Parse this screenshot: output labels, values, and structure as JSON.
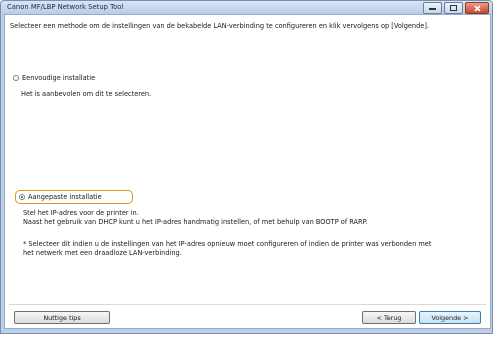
{
  "window": {
    "title": "Canon MF/LBP Network Setup Tool",
    "controls": [
      "minimize-icon",
      "maximize-icon",
      "close-icon"
    ]
  },
  "instruction": "Selecteer een methode om de instellingen van de bekabelde LAN-verbinding te configureren en klik vervolgens op [Volgende].",
  "options": [
    {
      "label": "Eenvoudige installatie",
      "selected": false,
      "description": "Het is aanbevolen om dit te selecteren."
    },
    {
      "label": "Aangepaste installatie",
      "selected": true,
      "description_line1": "Stel het IP-adres voor de printer in.",
      "description_line2": "Naast het gebruik van DHCP kunt u het IP-adres handmatig instellen, of met behulp van BOOTP of RARP.",
      "note_line1": "* Selecteer dit indien u de instellingen van het IP-adres opnieuw moet configureren of indien de printer was verbonden met",
      "note_line2": "het netwerk met een draadloze LAN-verbinding."
    }
  ],
  "buttons": {
    "tips": "Nuttige tips",
    "back": "< Terug",
    "next": "Volgende >"
  },
  "colors": {
    "highlight": "#e8921f",
    "radio_dot": "#1f4f9a"
  }
}
